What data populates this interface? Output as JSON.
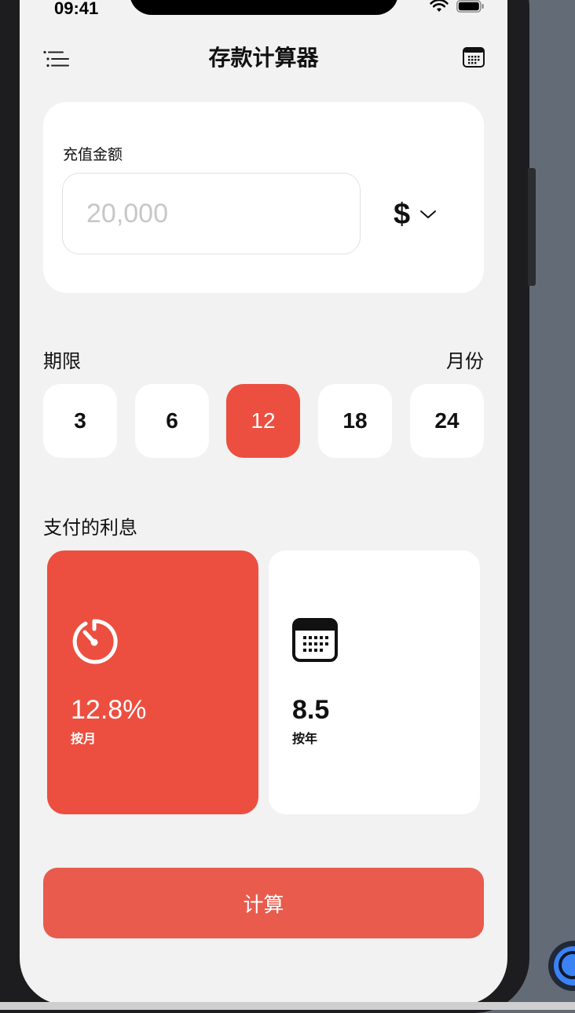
{
  "status_bar": {
    "time": "09:41"
  },
  "header": {
    "title": "存款计算器",
    "menu_icon": "menu-icon",
    "calendar_icon": "calendar-icon"
  },
  "deposit": {
    "label": "充值金额",
    "amount_placeholder": "20,000",
    "currency": "$"
  },
  "term": {
    "label": "期限",
    "unit": "月份",
    "options": [
      "3",
      "6",
      "12",
      "18",
      "24"
    ],
    "selected": "12"
  },
  "interest": {
    "label": "支付的利息",
    "monthly": {
      "value": "12.8%",
      "caption": "按月",
      "icon": "timer-icon"
    },
    "yearly": {
      "value": "8.5",
      "caption": "按年",
      "icon": "calendar-icon"
    }
  },
  "actions": {
    "calculate_label": "计算"
  },
  "colors": {
    "accent": "#ec4f40",
    "button": "#e85b4d",
    "background": "#f2f2f2"
  }
}
